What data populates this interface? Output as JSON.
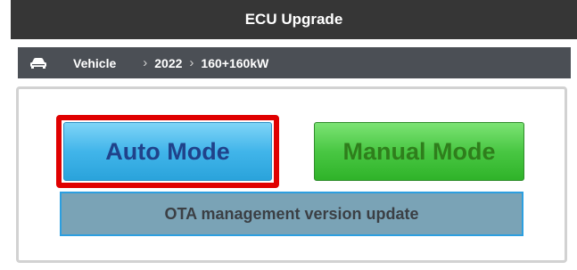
{
  "window": {
    "title": "ECU Upgrade"
  },
  "breadcrumb": {
    "icon": "car-icon",
    "items": [
      {
        "label": "Vehicle"
      },
      {
        "label": "2022"
      },
      {
        "label": "160+160kW"
      }
    ],
    "separator": "›"
  },
  "modes": {
    "auto_label": "Auto Mode",
    "manual_label": "Manual Mode",
    "ota_label": "OTA management version update",
    "highlighted": "Auto Mode"
  },
  "colors": {
    "title_bar": "#363636",
    "breadcrumb_bar": "#4b4f55",
    "auto_button": "#41b5ea",
    "manual_button": "#49c743",
    "ota_button": "#7aa3b6",
    "highlight_border": "#e00000"
  }
}
